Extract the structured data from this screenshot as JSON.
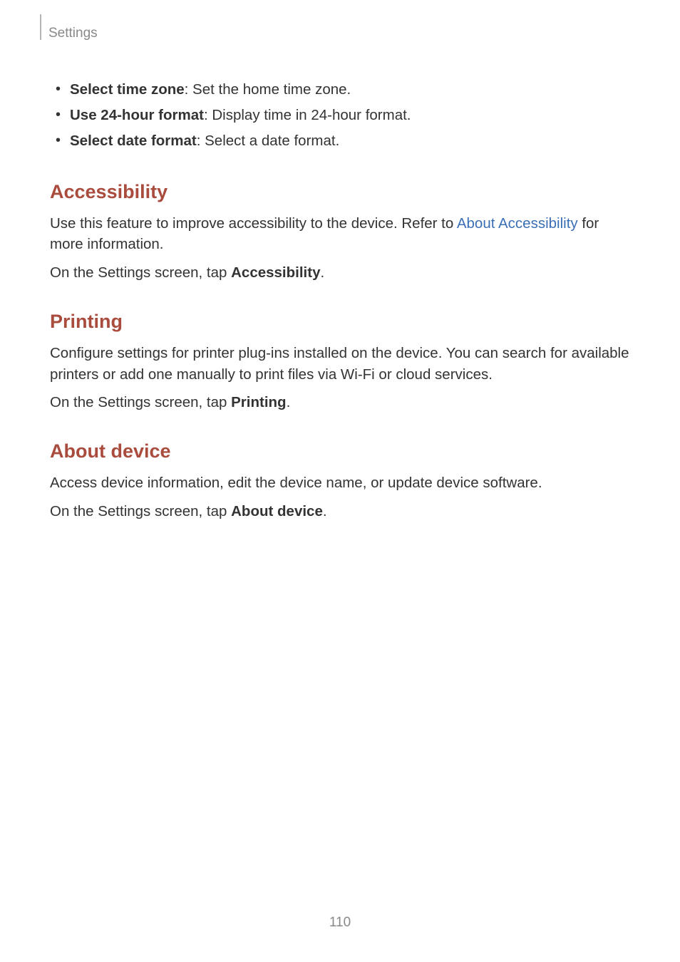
{
  "header": {
    "breadcrumb": "Settings"
  },
  "bullets": [
    {
      "bold": "Select time zone",
      "desc": ": Set the home time zone."
    },
    {
      "bold": "Use 24-hour format",
      "desc": ": Display time in 24-hour format."
    },
    {
      "bold": "Select date format",
      "desc": ": Select a date format."
    }
  ],
  "sections": {
    "accessibility": {
      "heading": "Accessibility",
      "intro_prefix": "Use this feature to improve accessibility to the device. Refer to ",
      "link_text": "About Accessibility",
      "intro_suffix": " for more information.",
      "tap_prefix": "On the Settings screen, tap ",
      "tap_bold": "Accessibility",
      "tap_suffix": "."
    },
    "printing": {
      "heading": "Printing",
      "desc": "Configure settings for printer plug-ins installed on the device. You can search for available printers or add one manually to print files via Wi-Fi or cloud services.",
      "tap_prefix": "On the Settings screen, tap ",
      "tap_bold": "Printing",
      "tap_suffix": "."
    },
    "about_device": {
      "heading": "About device",
      "desc": "Access device information, edit the device name, or update device software.",
      "tap_prefix": "On the Settings screen, tap ",
      "tap_bold": "About device",
      "tap_suffix": "."
    }
  },
  "page_number": "110"
}
